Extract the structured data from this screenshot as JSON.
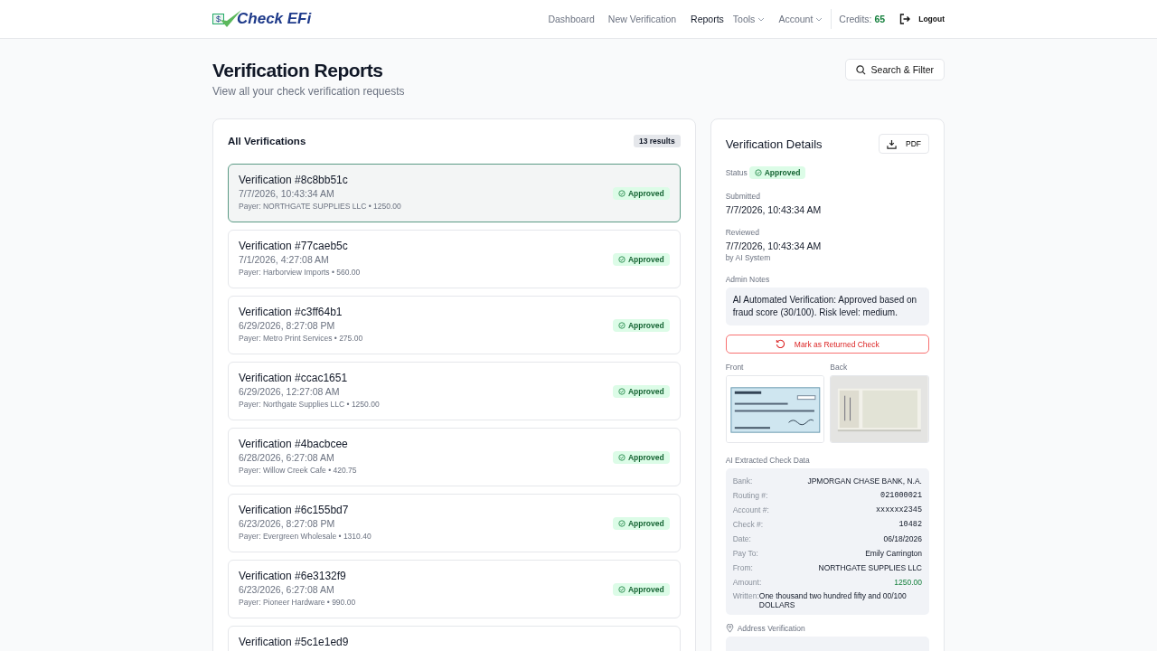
{
  "nav": {
    "logo_badge": "$",
    "logo": "Check EFi",
    "links": [
      {
        "label": "Dashboard",
        "selected": false,
        "dropdown": false
      },
      {
        "label": "New Verification",
        "selected": false,
        "dropdown": false
      },
      {
        "label": "Reports",
        "selected": true,
        "dropdown": false
      },
      {
        "label": "Tools",
        "selected": false,
        "dropdown": true
      },
      {
        "label": "Account",
        "selected": false,
        "dropdown": true
      }
    ],
    "credits_label": "Credits:",
    "credits": "65",
    "logout": "Logout"
  },
  "header": {
    "title": "Verification Reports",
    "subtitle": "View all your check verification requests",
    "search_button": "Search & Filter"
  },
  "list": {
    "title": "All Verifications",
    "count": "13 results",
    "items": [
      {
        "title": "Verification #8c8bb51c",
        "date": "7/7/2026, 10:43:34 AM",
        "payer": "Payer: NORTHGATE SUPPLIES LLC • 1250.00",
        "status": "Approved",
        "selected": true
      },
      {
        "title": "Verification #77caeb5c",
        "date": "7/1/2026, 4:27:08 AM",
        "payer": "Payer: Harborview Imports • 560.00",
        "status": "Approved",
        "selected": false
      },
      {
        "title": "Verification #c3ff64b1",
        "date": "6/29/2026, 8:27:08 PM",
        "payer": "Payer: Metro Print Services • 275.00",
        "status": "Approved",
        "selected": false
      },
      {
        "title": "Verification #ccac1651",
        "date": "6/29/2026, 12:27:08 AM",
        "payer": "Payer: Northgate Supplies LLC • 1250.00",
        "status": "Approved",
        "selected": false
      },
      {
        "title": "Verification #4bacbcee",
        "date": "6/28/2026, 6:27:08 AM",
        "payer": "Payer: Willow Creek Cafe • 420.75",
        "status": "Approved",
        "selected": false
      },
      {
        "title": "Verification #6c155bd7",
        "date": "6/23/2026, 8:27:08 PM",
        "payer": "Payer: Evergreen Wholesale • 1310.40",
        "status": "Approved",
        "selected": false
      },
      {
        "title": "Verification #6e3132f9",
        "date": "6/23/2026, 6:27:08 AM",
        "payer": "Payer: Pioneer Hardware • 990.00",
        "status": "Approved",
        "selected": false
      },
      {
        "title": "Verification #5c1e1ed9",
        "selected": false
      }
    ]
  },
  "details": {
    "title": "Verification Details",
    "pdf": "PDF",
    "status_label": "Status",
    "status": "Approved",
    "submitted_label": "Submitted",
    "submitted": "7/7/2026, 10:43:34 AM",
    "reviewed_label": "Reviewed",
    "reviewed": "7/7/2026, 10:43:34 AM",
    "reviewer": "by AI System",
    "notes_label": "Admin Notes",
    "notes": "AI Automated Verification: Approved based on fraud score (30/100). Risk level: medium.",
    "returned_button": "Mark as Returned Check",
    "front_label": "Front",
    "back_label": "Back",
    "extracted_label": "AI Extracted Check Data",
    "fields": [
      {
        "label": "Bank:",
        "value": "JPMORGAN CHASE BANK, N.A.",
        "kind": "text"
      },
      {
        "label": "Routing #:",
        "value": "021000021",
        "kind": "mono"
      },
      {
        "label": "Account #:",
        "value": "xxxxxx2345",
        "kind": "mono"
      },
      {
        "label": "Check #:",
        "value": "10482",
        "kind": "mono"
      },
      {
        "label": "Date:",
        "value": "06/18/2026",
        "kind": "text"
      },
      {
        "label": "Pay To:",
        "value": "Emily Carrington",
        "kind": "text"
      },
      {
        "label": "From:",
        "value": "NORTHGATE SUPPLIES LLC",
        "kind": "text"
      },
      {
        "label": "Amount:",
        "value": "1250.00",
        "kind": "amount"
      },
      {
        "label": "Written:",
        "value": "One thousand two hundred fifty and 00/100 DOLLARS",
        "kind": "written"
      }
    ],
    "address_label": "Address Verification"
  }
}
